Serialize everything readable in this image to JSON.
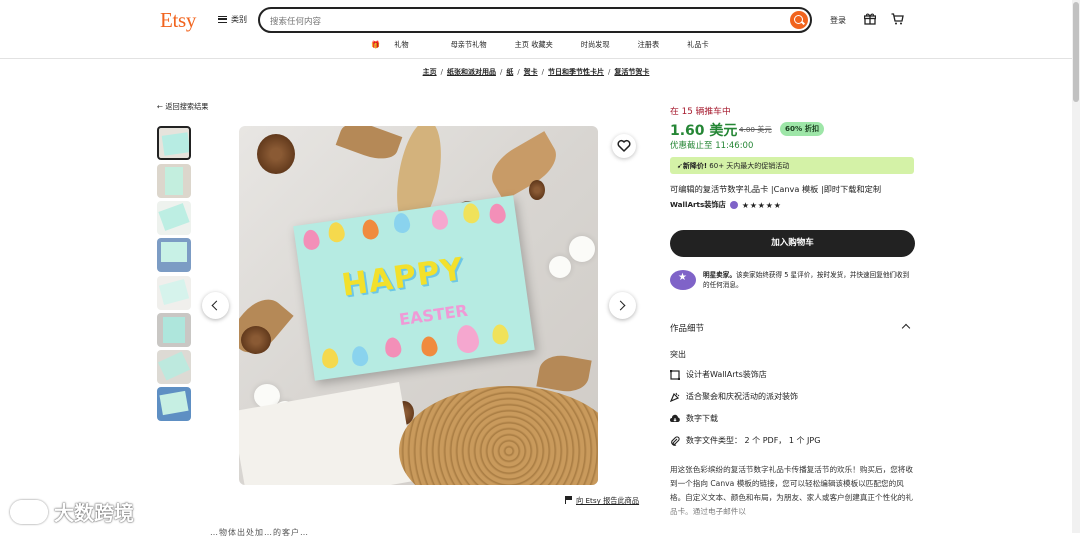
{
  "header": {
    "logo": "Etsy",
    "categories": "类别",
    "search_placeholder": "搜索任何内容",
    "login": "登录"
  },
  "subnav": [
    "礼物",
    "母亲节礼物",
    "主页 收藏夹",
    "时尚发现",
    "注册表",
    "礼品卡"
  ],
  "breadcrumbs": [
    "主页",
    "纸张和派对用品",
    "纸",
    "贺卡",
    "节日和季节性卡片",
    "复活节贺卡"
  ],
  "back_link": "返回搜索结果",
  "image": {
    "card_title": "HAPPY",
    "card_subtitle": "EASTER"
  },
  "report_link": "向 Etsy 报告此商品",
  "watermark": "大数跨境",
  "ghost_text": "…物体出处加…的客户…",
  "product": {
    "in_cart": "在 15 辆推车中",
    "price": "1.60 美元",
    "original_price": "4.00 美元",
    "discount": "60% 折扣",
    "deadline": "优惠截止至 11:46:00",
    "low_price_label": "新降价!",
    "low_price_text": " 60+ 天内最大的促销活动",
    "title": "可编辑的复活节数字礼品卡 |Canva 模板 |即时下载和定制",
    "shop_name": "WallArts装饰店",
    "stars": "★★★★★",
    "add_to_cart": "加入购物车",
    "star_seller_label": "明星卖家。",
    "star_seller_text": "该卖家始终获得 5 星评价，按时发货，并快速回复他们收到的任何消息。"
  },
  "details": {
    "heading": "作品细节",
    "highlights": "突出",
    "features": [
      {
        "icon": "designer-icon",
        "text": "设计者WallArts装饰店"
      },
      {
        "icon": "party-icon",
        "text": "适合聚会和庆祝活动的派对装饰"
      },
      {
        "icon": "cloud-download-icon",
        "text": "数字下载"
      },
      {
        "icon": "paperclip-icon",
        "text": "数字文件类型： 2 个 PDF， 1 个 JPG"
      }
    ],
    "description": "用这张色彩缤纷的复活节数字礼品卡传播复活节的欢乐！购买后，您将收到一个指向 Canva 模板的链接，您可以轻松编辑该模板以匹配您的风格。自定义文本、颜色和布局，为朋友、家人或客户创建真正个性化的礼品卡。通过电子邮件以"
  },
  "colors": {
    "brand": "#f1641e",
    "price_green": "#258635",
    "cart_red": "#a61a2e"
  }
}
